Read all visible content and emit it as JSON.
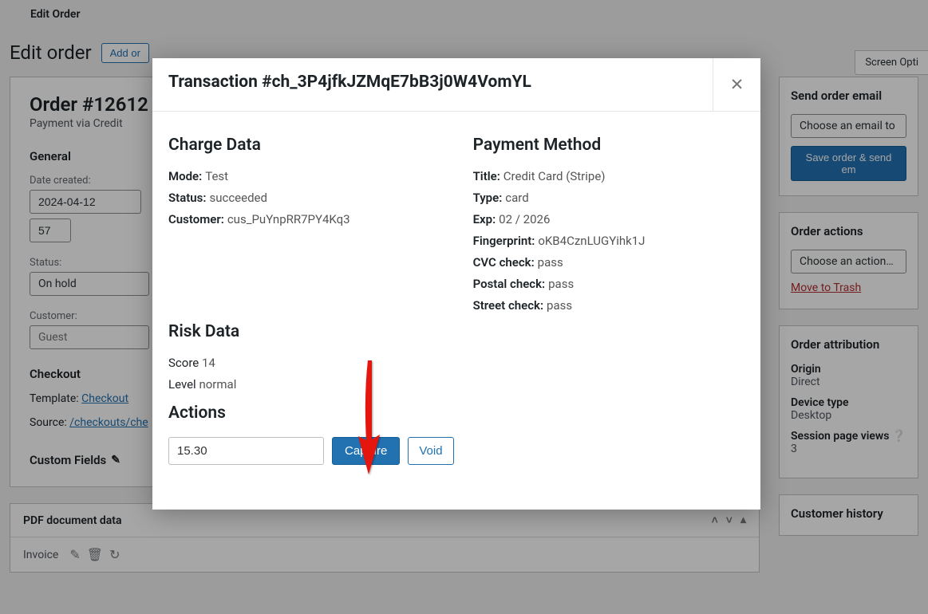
{
  "topbar": {
    "title": "Edit Order"
  },
  "page": {
    "title": "Edit order",
    "add_button": "Add or",
    "screen_options": "Screen Opti"
  },
  "order": {
    "title": "Order #12612",
    "subtitle": "Payment via Credit",
    "general_h": "General",
    "date_created_label": "Date created:",
    "date_value": "2024-04-12",
    "time_value": "57",
    "status_label": "Status:",
    "status_value": "On hold",
    "customer_label": "Customer:",
    "customer_value": "Guest",
    "checkout_h": "Checkout",
    "template_label": "Template: ",
    "template_link": "Checkout",
    "source_label": "Source: ",
    "source_link": "/checkouts/che",
    "custom_fields": "Custom Fields",
    "pdf_panel": "PDF document data",
    "invoice": "Invoice"
  },
  "side": {
    "email_h": "Send order email",
    "email_select": "Choose an email to ",
    "email_button": "Save order & send em",
    "actions_h": "Order actions",
    "actions_select": "Choose an action…",
    "trash": "Move to Trash",
    "attr_h": "Order attribution",
    "origin_l": "Origin",
    "origin_v": "Direct",
    "device_l": "Device type",
    "device_v": "Desktop",
    "views_l": "Session page views",
    "views_v": "3",
    "history_h": "Customer history"
  },
  "modal": {
    "title": "Transaction #ch_3P4jfkJZMqE7bB3j0W4VomYL",
    "charge_h": "Charge Data",
    "mode_l": "Mode:",
    "mode_v": "Test",
    "status_l": "Status:",
    "status_v": "succeeded",
    "customer_l": "Customer:",
    "customer_v": "cus_PuYnpRR7PY4Kq3",
    "payment_h": "Payment Method",
    "title_l": "Title:",
    "title_v": "Credit Card (Stripe)",
    "type_l": "Type:",
    "type_v": "card",
    "exp_l": "Exp:",
    "exp_v": "02 / 2026",
    "finger_l": "Fingerprint:",
    "finger_v": "oKB4CznLUGYihk1J",
    "cvc_l": "CVC check:",
    "cvc_v": "pass",
    "postal_l": "Postal check:",
    "postal_v": "pass",
    "street_l": "Street check:",
    "street_v": "pass",
    "risk_h": "Risk Data",
    "score_l": "Score",
    "score_v": "14",
    "level_l": "Level",
    "level_v": "normal",
    "actions_h": "Actions",
    "amount": "15.30",
    "capture": "Capture",
    "void": "Void"
  }
}
